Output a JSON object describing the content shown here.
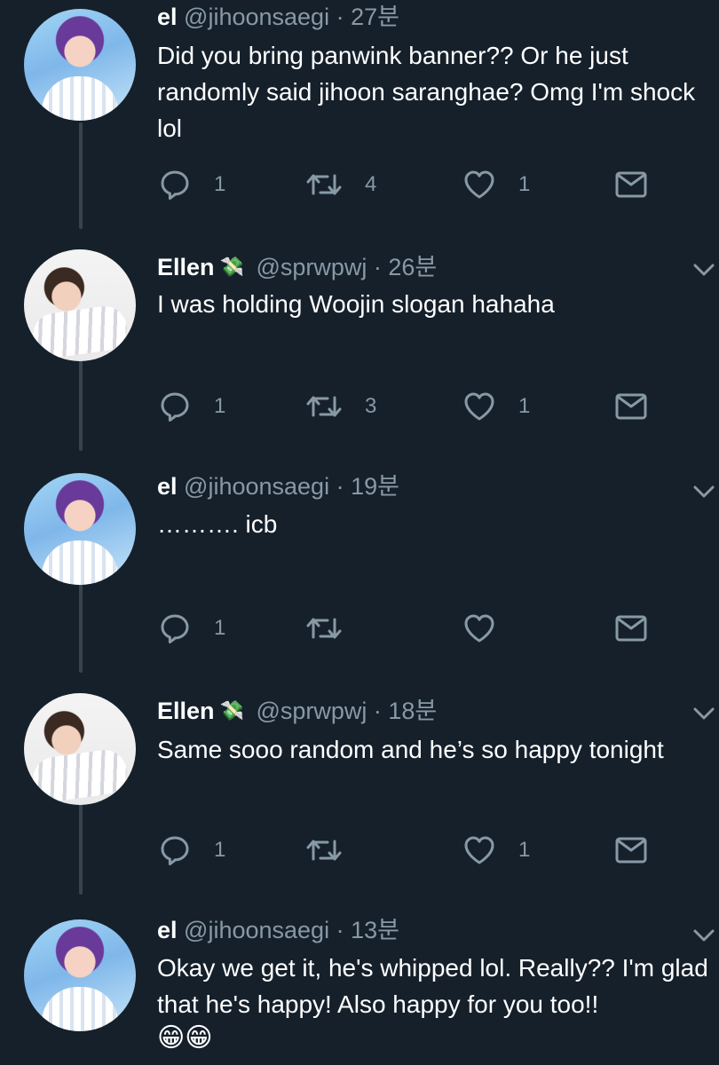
{
  "tweets": [
    {
      "name": "el",
      "handle": "@jihoonsaegi",
      "time": "· 27분",
      "text": "Did you bring panwink banner?? Or he just randomly said jihoon saranghae? Omg I'm shock lol",
      "avatar": "purple-hair-avatar",
      "replies": "1",
      "retweets": "4",
      "likes": "1"
    },
    {
      "name": "Ellen",
      "name_emoji": "💸",
      "handle": "@sprwpwj",
      "time": "· 26분",
      "text": "I was holding Woojin slogan hahaha",
      "avatar": "white-pillow-avatar",
      "replies": "1",
      "retweets": "3",
      "likes": "1"
    },
    {
      "name": "el",
      "handle": "@jihoonsaegi",
      "time": "· 19분",
      "text": "………. icb",
      "avatar": "purple-hair-avatar",
      "replies": "1",
      "retweets": "",
      "likes": ""
    },
    {
      "name": "Ellen",
      "name_emoji": "💸",
      "handle": "@sprwpwj",
      "time": "· 18분",
      "text": "Same sooo random and he’s so happy tonight",
      "avatar": "white-pillow-avatar",
      "replies": "1",
      "retweets": "",
      "likes": "1"
    },
    {
      "name": "el",
      "handle": "@jihoonsaegi",
      "time": "· 13분",
      "text": "Okay we get it, he's whipped lol. Really?? I'm glad that he's happy! Also happy for you too!!",
      "text_emoji": "😁😁",
      "avatar": "purple-hair-avatar"
    }
  ],
  "icons": {
    "reply": "reply-icon",
    "retweet": "retweet-icon",
    "like": "heart-icon",
    "dm": "envelope-icon",
    "more": "chevron-down-icon"
  },
  "colors": {
    "background": "#15202b",
    "secondary_text": "#8899a6",
    "thread_line": "#38444d"
  }
}
